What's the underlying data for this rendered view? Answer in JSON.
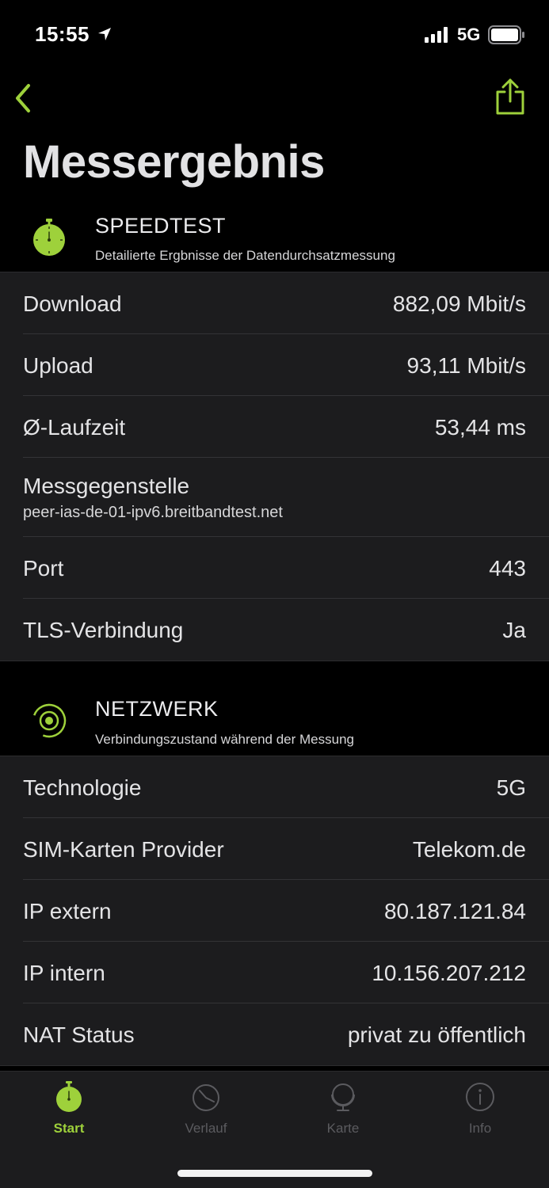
{
  "status_bar": {
    "time": "15:55",
    "network": "5G",
    "icons": [
      "location-arrow-icon",
      "signal-icon",
      "battery-icon"
    ]
  },
  "nav": {
    "back_icon": "chevron-left-icon",
    "share_icon": "share-icon",
    "title": "Messergebnis"
  },
  "colors": {
    "accent": "#9ed13b",
    "background": "#000000",
    "group_background": "#1c1c1e",
    "inactive_tab": "#5b5b5f"
  },
  "speedtest": {
    "icon": "stopwatch-icon",
    "title": "SPEEDTEST",
    "subtitle": "Detailierte Ergbnisse der Datendurchsatzmessung",
    "rows": [
      {
        "label": "Download",
        "value": "882,09 Mbit/s"
      },
      {
        "label": "Upload",
        "value": "93,11 Mbit/s"
      },
      {
        "label": "Ø-Laufzeit",
        "value": "53,44 ms"
      },
      {
        "label": "Messgegenstelle",
        "sub": "peer-ias-de-01-ipv6.breitbandtest.net"
      },
      {
        "label": "Port",
        "value": "443"
      },
      {
        "label": "TLS-Verbindung",
        "value": "Ja"
      }
    ]
  },
  "network": {
    "icon": "network-radar-icon",
    "title": "NETZWERK",
    "subtitle": "Verbindungszustand während der Messung",
    "rows": [
      {
        "label": "Technologie",
        "value": "5G"
      },
      {
        "label": "SIM-Karten Provider",
        "value": "Telekom.de"
      },
      {
        "label": "IP extern",
        "value": "80.187.121.84"
      },
      {
        "label": "IP intern",
        "value": "10.156.207.212"
      },
      {
        "label": "NAT Status",
        "value": "privat zu öffentlich"
      }
    ]
  },
  "tabs": [
    {
      "label": "Start",
      "icon": "stopwatch-icon",
      "active": true
    },
    {
      "label": "Verlauf",
      "icon": "history-icon",
      "active": false
    },
    {
      "label": "Karte",
      "icon": "globe-icon",
      "active": false
    },
    {
      "label": "Info",
      "icon": "info-icon",
      "active": false
    }
  ]
}
